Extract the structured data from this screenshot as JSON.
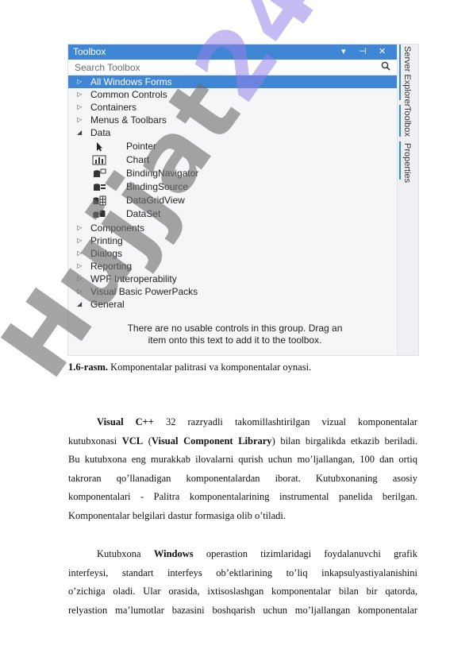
{
  "toolbox": {
    "title": "Toolbox",
    "title_icons": [
      "▾",
      "⊣",
      "✕"
    ],
    "search_placeholder": "Search Toolbox",
    "search_icon": "search-icon",
    "categories_top": [
      {
        "label": "All Windows Forms",
        "expanded": false,
        "selected": true
      },
      {
        "label": "Common Controls",
        "expanded": false
      },
      {
        "label": "Containers",
        "expanded": false
      },
      {
        "label": "Menus & Toolbars",
        "expanded": false
      },
      {
        "label": "Data",
        "expanded": true
      }
    ],
    "data_items": [
      {
        "label": "Pointer",
        "icon": "pointer-icon"
      },
      {
        "label": "Chart",
        "icon": "chart-icon"
      },
      {
        "label": "BindingNavigator",
        "icon": "binding-navigator-icon"
      },
      {
        "label": "BindingSource",
        "icon": "binding-source-icon"
      },
      {
        "label": "DataGridView",
        "icon": "datagridview-icon"
      },
      {
        "label": "DataSet",
        "icon": "dataset-icon"
      }
    ],
    "categories_bottom": [
      {
        "label": "Components",
        "expanded": false
      },
      {
        "label": "Printing",
        "expanded": false
      },
      {
        "label": "Dialogs",
        "expanded": false
      },
      {
        "label": "Reporting",
        "expanded": false
      },
      {
        "label": "WPF Interoperability",
        "expanded": false
      },
      {
        "label": "Visual Basic PowerPacks",
        "expanded": false
      },
      {
        "label": "General",
        "expanded": true
      }
    ],
    "empty_note_line1": "There are no usable controls in this group. Drag an",
    "empty_note_line2": "item onto this text to add it to the toolbox.",
    "side_tabs": [
      "Server Explorer",
      "Toolbox",
      "Properties"
    ],
    "accent_color": "#3f86d4"
  },
  "caption": {
    "number": "1.6-rasm.",
    "text": " Komponentalar palitrasi va komponentalar oynasi."
  },
  "paragraph1": {
    "lines": [
      "Visual C++ 32 razryadli takomillashtirilgan vizual komponentalar",
      "kutubxonasi VCL (Visual Component Library) bilan birgalikda etkazib beriladi.",
      "Bu kutubxona eng murakkab ilovalarni qurish uchun mo’ljallangan, 100 dan ortiq",
      "takroran qo’llanadigan komponentalardan iborat. Kutubxonaning asosiy",
      "komponentalari - Palitra komponentalarining instrumental panelida berilgan.",
      "Komponentalar belgilari dastur formasiga olib o’tiladi."
    ]
  },
  "paragraph2": {
    "lines": [
      "Kutubxona Windows operastion tizimlaridagi foydalanuvchi grafik",
      "interfeysi, standart interfeys ob’ektlarining to’liq inkapsulyastiyalanishini",
      "o’zichiga oladi. Ular orasida, ixtisoslashgan komponentalar bilan bir qatorda,",
      "relyastion ma’lumotlar bazasini boshqarish uchun mo’ljallangan komponentalar"
    ]
  },
  "watermark": {
    "part1": "Hujjat",
    "part2": "24"
  }
}
